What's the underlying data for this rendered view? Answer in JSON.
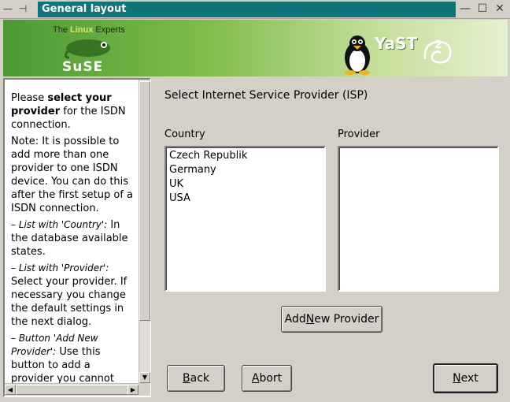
{
  "window": {
    "title": "General layout",
    "controls_left": "— ⊣",
    "minimize": "—",
    "maximize": "☐",
    "close": "✕"
  },
  "banner": {
    "tagline_pre": "The ",
    "tagline_highlight": "Linux",
    "tagline_post": " Experts",
    "suse_logo_text": "SuSE",
    "yast_text": "YaST"
  },
  "help": {
    "p1_pre": "Please ",
    "p1_bold": "select your provider",
    "p1_post": " for the ISDN connection.",
    "p2": "Note: It is possible to add more than one provider to one ISDN device. You can do this after the first setup of a ISDN connection.",
    "p3_italic": "– List with 'Country':",
    "p3_post": " In the database available states.",
    "p4_italic": "– List with 'Provider':",
    "p4_post": " Select your provider. If necessary you change the default settings in the next dialog.",
    "p5_italic": "– Button 'Add New Provider':",
    "p5_post": " Use this button to add a provider you cannot"
  },
  "main": {
    "heading": "Select Internet Service Provider (ISP)",
    "country_label": "Country",
    "provider_label": "Provider",
    "countries": [
      "Czech Republik",
      "Germany",
      "UK",
      "USA"
    ],
    "providers": []
  },
  "buttons": {
    "add_new_provider_pre": "Add ",
    "add_new_provider_u": "N",
    "add_new_provider_post": "ew Provider",
    "back_u": "B",
    "back_post": "ack",
    "abort_u": "A",
    "abort_post": "bort",
    "next_u": "N",
    "next_post": "ext"
  },
  "colors": {
    "titlebar": "#0f7478",
    "dialog_bg": "#d4d0c8",
    "banner_green": "#4c9a34"
  }
}
